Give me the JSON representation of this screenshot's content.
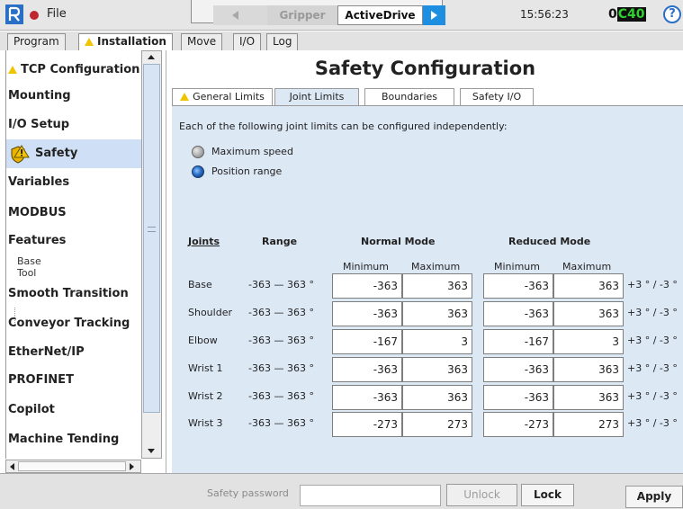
{
  "topbar": {
    "file_label": "File",
    "tab_previous": "Gripper",
    "tab_current": "ActiveDrive",
    "clock": "15:56:23",
    "speed_left": "0",
    "speed_right": "C40",
    "help_glyph": "?"
  },
  "main_tabs": [
    "Program",
    "Installation",
    "Move",
    "I/O",
    "Log"
  ],
  "sidebar": {
    "items": [
      "TCP Configuration",
      "Mounting",
      "I/O Setup",
      "Safety",
      "Variables",
      "MODBUS",
      "Features",
      "Smooth Transition",
      "Conveyor Tracking",
      "EtherNet/IP",
      "PROFINET",
      "Copilot",
      "Machine Tending"
    ],
    "features_children": [
      "Base",
      "Tool"
    ],
    "selected": "Safety"
  },
  "page": {
    "title": "Safety Configuration",
    "subtabs": [
      "General Limits",
      "Joint Limits",
      "Boundaries",
      "Safety I/O"
    ],
    "active_subtab": "Joint Limits",
    "intro": "Each of the following joint limits can be configured independently:",
    "radio_max_speed": "Maximum speed",
    "radio_position_range": "Position range",
    "selected_radio": "Position range"
  },
  "table": {
    "headers": {
      "joints": "Joints",
      "range": "Range",
      "normal": "Normal Mode",
      "reduced": "Reduced Mode"
    },
    "subheaders": {
      "minimum": "Minimum",
      "maximum": "Maximum"
    },
    "rows": [
      {
        "joint": "Base",
        "range": "-363 — 363 °",
        "normal_min": "-363",
        "normal_max": "363",
        "reduced_min": "-363",
        "reduced_max": "363",
        "tolerance": "+3 ° / -3 °"
      },
      {
        "joint": "Shoulder",
        "range": "-363 — 363 °",
        "normal_min": "-363",
        "normal_max": "363",
        "reduced_min": "-363",
        "reduced_max": "363",
        "tolerance": "+3 ° / -3 °"
      },
      {
        "joint": "Elbow",
        "range": "-363 — 363 °",
        "normal_min": "-167",
        "normal_max": "3",
        "reduced_min": "-167",
        "reduced_max": "3",
        "tolerance": "+3 ° / -3 °"
      },
      {
        "joint": "Wrist 1",
        "range": "-363 — 363 °",
        "normal_min": "-363",
        "normal_max": "363",
        "reduced_min": "-363",
        "reduced_max": "363",
        "tolerance": "+3 ° / -3 °"
      },
      {
        "joint": "Wrist 2",
        "range": "-363 — 363 °",
        "normal_min": "-363",
        "normal_max": "363",
        "reduced_min": "-363",
        "reduced_max": "363",
        "tolerance": "+3 ° / -3 °"
      },
      {
        "joint": "Wrist 3",
        "range": "-363 — 363 °",
        "normal_min": "-273",
        "normal_max": "273",
        "reduced_min": "-273",
        "reduced_max": "273",
        "tolerance": "+3 ° / -3 °"
      }
    ]
  },
  "bottom": {
    "password_label": "Safety password",
    "password_value": "",
    "unlock_label": "Unlock",
    "lock_label": "Lock",
    "apply_label": "Apply"
  },
  "colors": {
    "accent_blue": "#1e8fe0",
    "panel_bg": "#dde8f5",
    "selected_item": "#cfe0f6",
    "speed_text": "#2fd02f",
    "warning": "#f0c400"
  }
}
